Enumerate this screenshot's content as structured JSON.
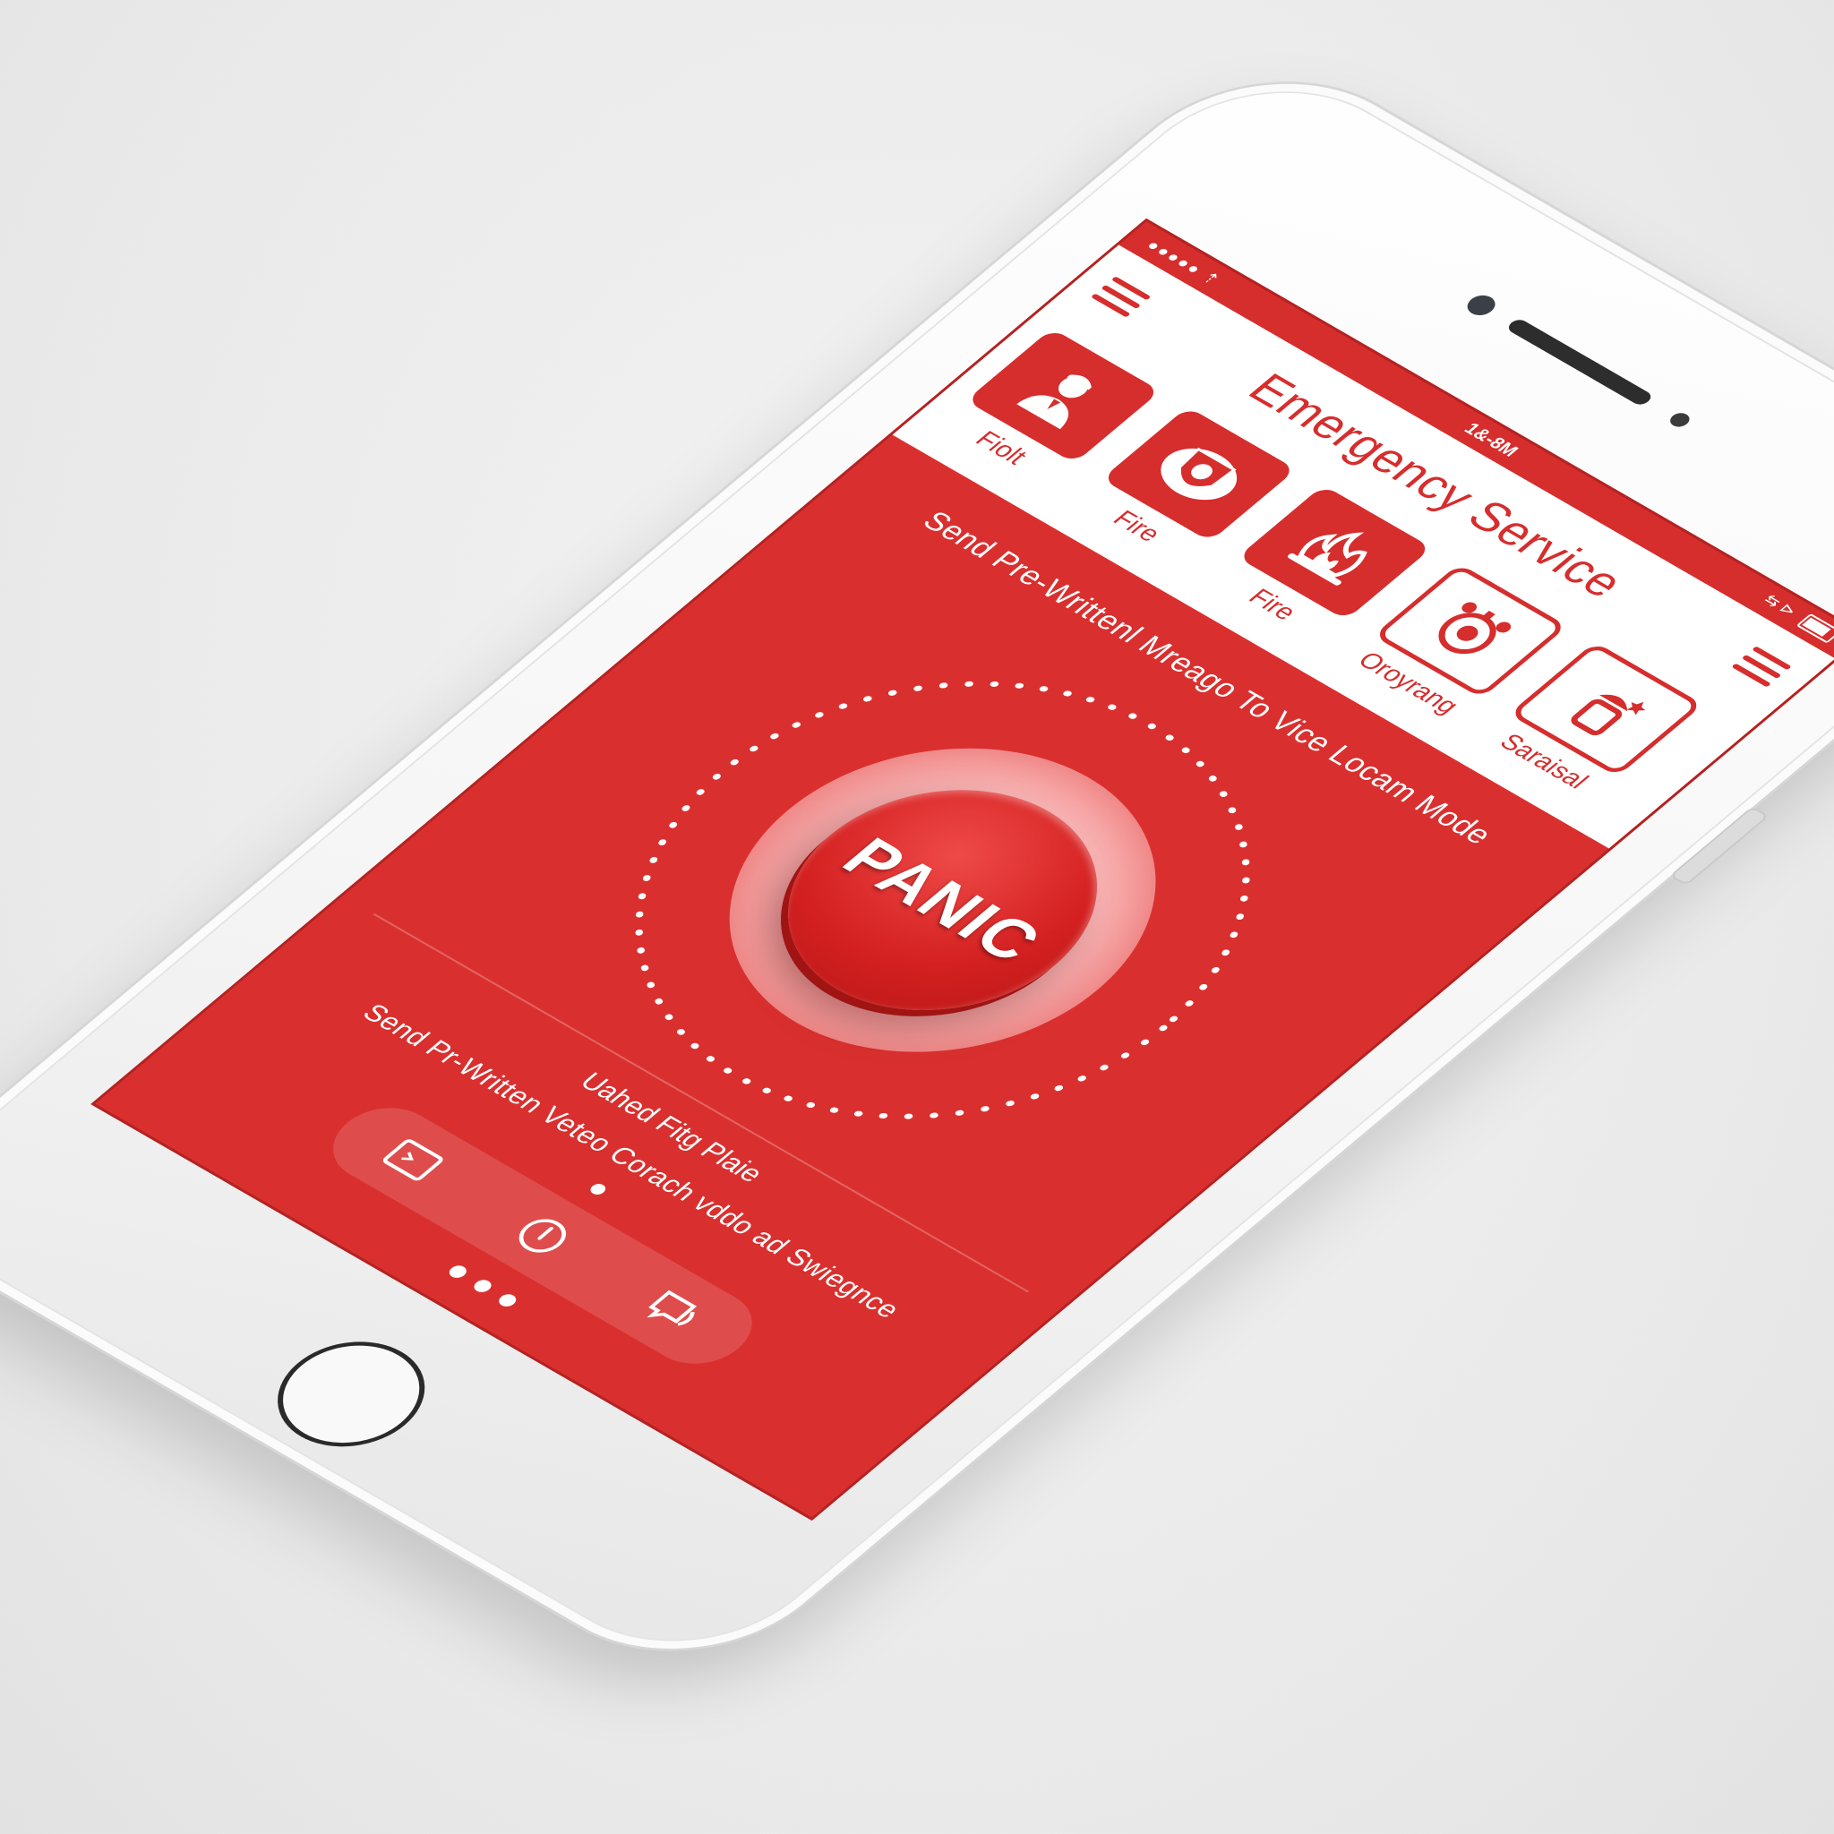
{
  "status_bar": {
    "signal": "●●●●● ⇡",
    "time": "1&-8M",
    "carrier_right": "⇆ ⊳"
  },
  "app": {
    "title": "Emergency Service"
  },
  "categories": [
    {
      "label": "Fiolt",
      "icon": "police-officer-icon"
    },
    {
      "label": "Fire",
      "icon": "fire-badge-icon"
    },
    {
      "label": "Fire",
      "icon": "flame-icon"
    },
    {
      "label": "Oroyrang",
      "icon": "alarm-clock-icon"
    },
    {
      "label": "Saraisal",
      "icon": "extinguisher-icon"
    }
  ],
  "subtitle": "Send Pre-Writtenl Mreago To Vice Locam Mode",
  "panic": {
    "label": "PANIC"
  },
  "caption": "Uahed Fitg Plaie",
  "footer_text": "Send Pr-Written Veteo Corach vddo ad Swiegnce",
  "action_bar": [
    {
      "icon": "message-icon"
    },
    {
      "icon": "power-icon"
    },
    {
      "icon": "chat-icon"
    }
  ],
  "colors": {
    "brand_red": "#d62d2d",
    "screen_red": "#d9302f",
    "white": "#ffffff"
  }
}
